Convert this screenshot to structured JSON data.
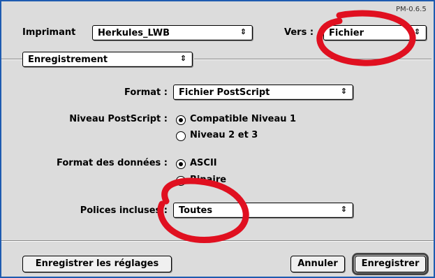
{
  "version": "PM-0.6.5",
  "printer": {
    "label": "Imprimant",
    "value": "Herkules_LWB"
  },
  "destination": {
    "label": "Vers :",
    "value": "Fichier"
  },
  "panel": {
    "value": "Enregistrement"
  },
  "format": {
    "label": "Format :",
    "value": "Fichier PostScript"
  },
  "postscript_level": {
    "label": "Niveau PostScript :",
    "options": [
      {
        "label": "Compatible Niveau 1",
        "selected": true
      },
      {
        "label": "Niveau 2 et 3",
        "selected": false
      }
    ]
  },
  "data_format": {
    "label": "Format des données :",
    "options": [
      {
        "label": "ASCII",
        "selected": true
      },
      {
        "label": "Binaire",
        "selected": false
      }
    ]
  },
  "fonts": {
    "label": "Polices incluses :",
    "value": "Toutes"
  },
  "buttons": {
    "save_settings": "Enregistrer les réglages",
    "cancel": "Annuler",
    "save": "Enregistrer"
  },
  "colors": {
    "annotation": "#e01020",
    "frame": "#1e5bb0"
  }
}
